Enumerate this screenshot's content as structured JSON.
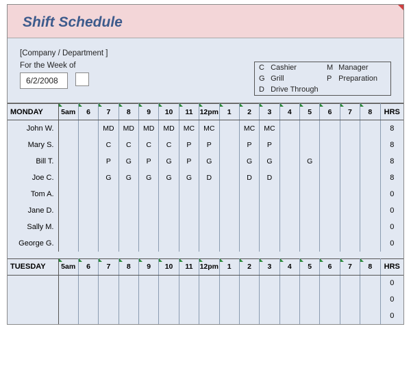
{
  "title": "Shift Schedule",
  "company_placeholder": "[Company / Department ]",
  "week_label": "For the Week of",
  "week_date": "6/2/2008",
  "legend": [
    {
      "code": "C",
      "label": "Cashier"
    },
    {
      "code": "M",
      "label": "Manager"
    },
    {
      "code": "G",
      "label": "Grill"
    },
    {
      "code": "P",
      "label": "Preparation"
    },
    {
      "code": "D",
      "label": "Drive Through"
    }
  ],
  "time_headers": [
    "5am",
    "6",
    "7",
    "8",
    "9",
    "10",
    "11",
    "12pm",
    "1",
    "2",
    "3",
    "4",
    "5",
    "6",
    "7",
    "8"
  ],
  "hrs_label": "HRS",
  "days": [
    {
      "name": "MONDAY",
      "rows": [
        {
          "name": "John W.",
          "cells": [
            "",
            "",
            "MD",
            "MD",
            "MD",
            "MD",
            "MC",
            "MC",
            "",
            "MC",
            "MC",
            "",
            "",
            "",
            "",
            ""
          ],
          "hrs": "8"
        },
        {
          "name": "Mary S.",
          "cells": [
            "",
            "",
            "C",
            "C",
            "C",
            "C",
            "P",
            "P",
            "",
            "P",
            "P",
            "",
            "",
            "",
            "",
            ""
          ],
          "hrs": "8"
        },
        {
          "name": "Bill T.",
          "cells": [
            "",
            "",
            "P",
            "G",
            "P",
            "G",
            "P",
            "G",
            "",
            "G",
            "G",
            "",
            "G",
            "",
            "",
            ""
          ],
          "hrs": "8"
        },
        {
          "name": "Joe C.",
          "cells": [
            "",
            "",
            "G",
            "G",
            "G",
            "G",
            "G",
            "D",
            "",
            "D",
            "D",
            "",
            "",
            "",
            "",
            ""
          ],
          "hrs": "8"
        },
        {
          "name": "Tom A.",
          "cells": [
            "",
            "",
            "",
            "",
            "",
            "",
            "",
            "",
            "",
            "",
            "",
            "",
            "",
            "",
            "",
            ""
          ],
          "hrs": "0"
        },
        {
          "name": "Jane D.",
          "cells": [
            "",
            "",
            "",
            "",
            "",
            "",
            "",
            "",
            "",
            "",
            "",
            "",
            "",
            "",
            "",
            ""
          ],
          "hrs": "0"
        },
        {
          "name": "Sally M.",
          "cells": [
            "",
            "",
            "",
            "",
            "",
            "",
            "",
            "",
            "",
            "",
            "",
            "",
            "",
            "",
            "",
            ""
          ],
          "hrs": "0"
        },
        {
          "name": "George G.",
          "cells": [
            "",
            "",
            "",
            "",
            "",
            "",
            "",
            "",
            "",
            "",
            "",
            "",
            "",
            "",
            "",
            ""
          ],
          "hrs": "0"
        }
      ]
    },
    {
      "name": "TUESDAY",
      "rows": [
        {
          "name": "",
          "cells": [
            "",
            "",
            "",
            "",
            "",
            "",
            "",
            "",
            "",
            "",
            "",
            "",
            "",
            "",
            "",
            ""
          ],
          "hrs": "0"
        },
        {
          "name": "",
          "cells": [
            "",
            "",
            "",
            "",
            "",
            "",
            "",
            "",
            "",
            "",
            "",
            "",
            "",
            "",
            "",
            ""
          ],
          "hrs": "0"
        },
        {
          "name": "",
          "cells": [
            "",
            "",
            "",
            "",
            "",
            "",
            "",
            "",
            "",
            "",
            "",
            "",
            "",
            "",
            "",
            ""
          ],
          "hrs": "0"
        }
      ]
    }
  ],
  "chart_data": {
    "type": "table",
    "title": "Shift Schedule",
    "week_of": "6/2/2008",
    "legend": {
      "C": "Cashier",
      "M": "Manager",
      "G": "Grill",
      "P": "Preparation",
      "D": "Drive Through"
    },
    "hours": [
      "5am",
      "6",
      "7",
      "8",
      "9",
      "10",
      "11",
      "12pm",
      "1",
      "2",
      "3",
      "4",
      "5",
      "6",
      "7",
      "8"
    ],
    "monday": {
      "John W.": {
        "7": "MD",
        "8": "MD",
        "9": "MD",
        "10": "MD",
        "11": "MC",
        "12pm": "MC",
        "2": "MC",
        "3": "MC",
        "HRS": 8
      },
      "Mary S.": {
        "7": "C",
        "8": "C",
        "9": "C",
        "10": "C",
        "11": "P",
        "12pm": "P",
        "2": "P",
        "3": "P",
        "HRS": 8
      },
      "Bill T.": {
        "7": "P",
        "8": "G",
        "9": "P",
        "10": "G",
        "11": "P",
        "12pm": "G",
        "2": "G",
        "3": "G",
        "5": "G",
        "HRS": 8
      },
      "Joe C.": {
        "7": "G",
        "8": "G",
        "9": "G",
        "10": "G",
        "11": "G",
        "12pm": "D",
        "2": "D",
        "3": "D",
        "HRS": 8
      },
      "Tom A.": {
        "HRS": 0
      },
      "Jane D.": {
        "HRS": 0
      },
      "Sally M.": {
        "HRS": 0
      },
      "George G.": {
        "HRS": 0
      }
    },
    "tuesday": {}
  }
}
